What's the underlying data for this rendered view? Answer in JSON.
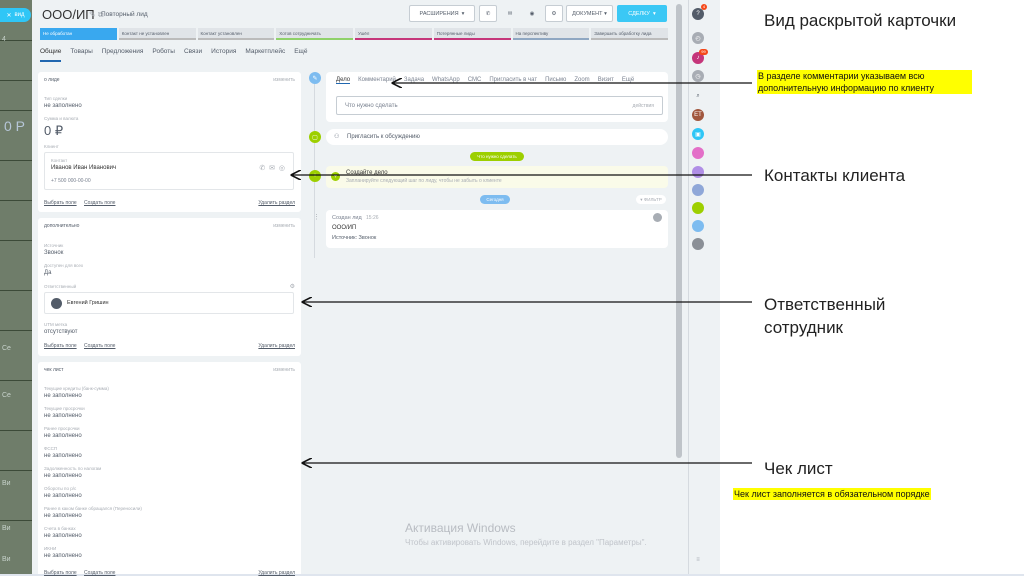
{
  "background": {
    "left_texts": [
      "вид",
      "4",
      "0 Р",
      "Се",
      "Се",
      "Ви",
      "Ви",
      "Ви"
    ]
  },
  "close_tab": {
    "label": "вид"
  },
  "card": {
    "title": "ООО/ИП",
    "subtitle": "Повторный лид"
  },
  "toolbar": {
    "extensions": "РАСШИРЕНИЯ",
    "document": "ДОКУМЕНТ",
    "deal": "СДЕЛКУ"
  },
  "stages": [
    "Не обработан",
    "Контакт не установлен",
    "Контакт установлен",
    "Хотов сотрудничать",
    "Ушёл",
    "Потерянные лиды",
    "На перспективу",
    "Завершить обработку лида"
  ],
  "tabs": [
    "Общие",
    "Товары",
    "Предложения",
    "Роботы",
    "Связи",
    "История",
    "Маркетплейс",
    "Ещё"
  ],
  "about": {
    "header": "о лиде",
    "edit": "изменить",
    "f1_label": "Тип сделки",
    "f1_value": "не заполнено",
    "f2_label": "Сумма и валюта",
    "f2_value": "0 ₽",
    "f3_label": "Клиент",
    "contact_label": "Контакт",
    "contact_name": "Иванов Иван Иванович",
    "contact_phone": "+7 500 000-00-00",
    "select": "Выбрать поле",
    "create": "Создать поле",
    "delete": "Удалить раздел"
  },
  "additional": {
    "header": "дополнительно",
    "edit": "изменить",
    "source_label": "Источник",
    "source_value": "Звонок",
    "access_label": "Доступен для всех",
    "access_value": "Да",
    "resp_label": "Ответственный",
    "resp_name": "Евгений Гришин",
    "utm_label": "UTM метка",
    "utm_value": "отсутствуют",
    "select": "Выбрать поле",
    "create": "Создать поле",
    "delete": "Удалить раздел"
  },
  "checklist": {
    "header": "чек лист",
    "edit": "изменить",
    "fields": [
      {
        "label": "Текущие кредиты (банк-сумма)",
        "value": "не заполнено"
      },
      {
        "label": "Текущие просрочки",
        "value": "не заполнено"
      },
      {
        "label": "Ранее просрочки",
        "value": "не заполнено"
      },
      {
        "label": "ФССП",
        "value": "не заполнено"
      },
      {
        "label": "Задолженность по налогам",
        "value": "не заполнено"
      },
      {
        "label": "Обороты по р/с",
        "value": "не заполнено"
      },
      {
        "label": "Ранее в каком банке обращался (Переносили)",
        "value": "не заполнено"
      },
      {
        "label": "Счета в банках",
        "value": "не заполнено"
      },
      {
        "label": "ИКНИ",
        "value": "не заполнено"
      }
    ],
    "select": "Выбрать поле",
    "create": "Создать поле",
    "delete": "Удалить раздел"
  },
  "timeline": {
    "tabs": [
      "Дело",
      "Комментарий",
      "Задача",
      "WhatsApp",
      "СМС",
      "Пригласить в чат",
      "Письмо",
      "Zoom",
      "Визит",
      "Ещё"
    ],
    "todo_placeholder": "Что нужно сделать",
    "todo_action": "действия",
    "invite": "Пригласить к обсуждению",
    "need_pill": "Что нужно сделать",
    "create_title": "Создайте дело",
    "create_sub": "Запланируйте следующий шаг по лиду, чтобы не забыть о клиенте",
    "today_pill": "Сегодня",
    "filter": "ФИЛЬТР",
    "created_label": "Создан лид",
    "created_time": "15:26",
    "created_name": "ООО/ИП",
    "created_source": "Источник: Звонок"
  },
  "watermark": {
    "line1": "Активация Windows",
    "line2": "Чтобы активировать Windows, перейдите в раздел \"Параметры\"."
  },
  "annotations": {
    "title": "Вид раскрытой карточки",
    "comments_note": "В разделе комментарии указываем всю дополнительную информацию по клиенту",
    "contacts": "Контакты клиента",
    "responsible": "Ответственный сотрудник",
    "checklist": "Чек лист",
    "checklist_note": "Чек лист заполняется в обязательном порядке"
  },
  "right_badges": {
    "help": "?",
    "bell": "4",
    "chat": "99",
    "avatar1": "ЕТ"
  }
}
